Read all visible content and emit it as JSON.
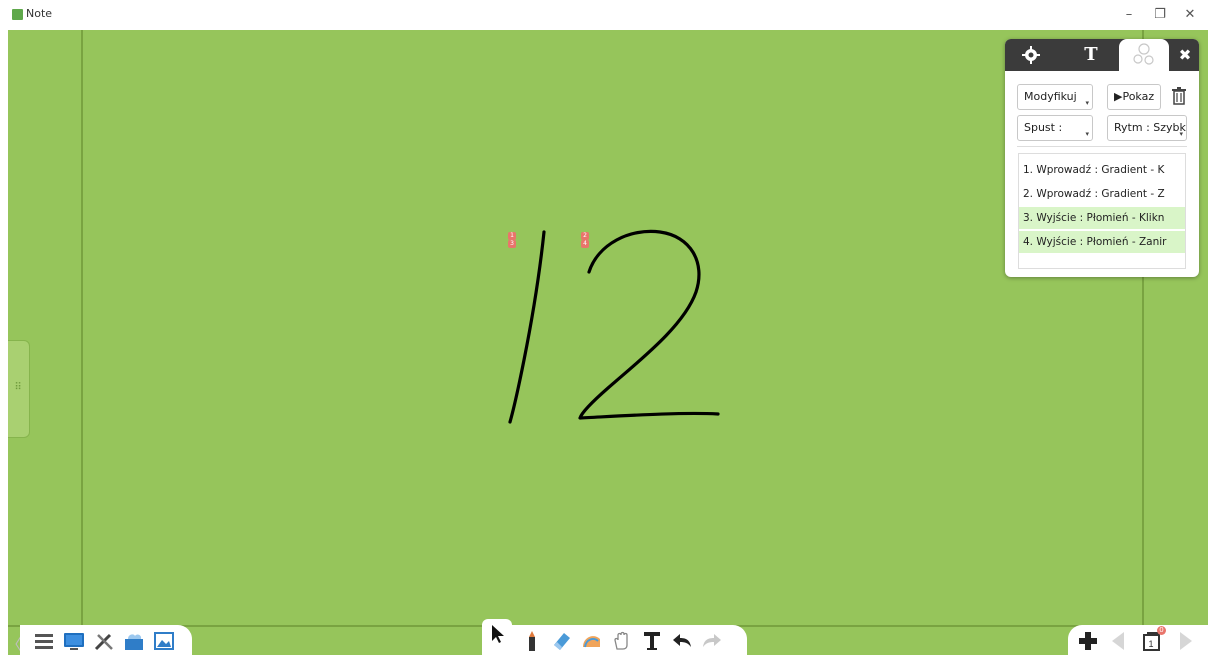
{
  "window": {
    "title": "Note",
    "minimize_glyph": "–",
    "maximize_glyph": "❐",
    "close_glyph": "✕"
  },
  "colors": {
    "board": "#96c55b",
    "panel_header": "#3b3b3b",
    "exit_highlight": "#d9f5c8",
    "order_tag": "#e9756b"
  },
  "drawing": {
    "strokes": "1 2 (handwritten)",
    "tags": [
      {
        "id": "tag-1",
        "labels": [
          "1",
          "3"
        ]
      },
      {
        "id": "tag-2",
        "labels": [
          "2",
          "4"
        ]
      }
    ]
  },
  "animation_panel": {
    "tabs": [
      {
        "icon": "gear-icon",
        "label": ""
      },
      {
        "icon": "text-icon",
        "label": "T"
      },
      {
        "icon": "animation-icon",
        "label": ""
      }
    ],
    "close_label": "✖",
    "modify_button": "Modyfikuj",
    "show_button": "▶Pokaz",
    "trigger_button": "Spust :",
    "rhythm_button": "Rytm : Szybko",
    "sequence": [
      {
        "label": "1. Wprowadź : Gradient - K",
        "kind": "entry"
      },
      {
        "label": "2. Wprowadź : Gradient - Z",
        "kind": "entry"
      },
      {
        "label": "3. Wyjście : Płomień - Klikn",
        "kind": "exit"
      },
      {
        "label": "4. Wyjście : Płomień - Zanir",
        "kind": "exit"
      }
    ]
  },
  "toolbars": {
    "left": [
      "menu-icon",
      "display-icon",
      "tools-icon",
      "cloud-icon",
      "gallery-icon"
    ],
    "middle": [
      "pointer-icon",
      "pen-icon",
      "eraser-icon",
      "shape-icon",
      "hand-icon",
      "text-tool-icon",
      "undo-icon",
      "redo-icon"
    ],
    "right": [
      "add-page-icon",
      "prev-page-icon",
      "page-count-icon",
      "next-page-icon"
    ],
    "page_badge": "0"
  }
}
